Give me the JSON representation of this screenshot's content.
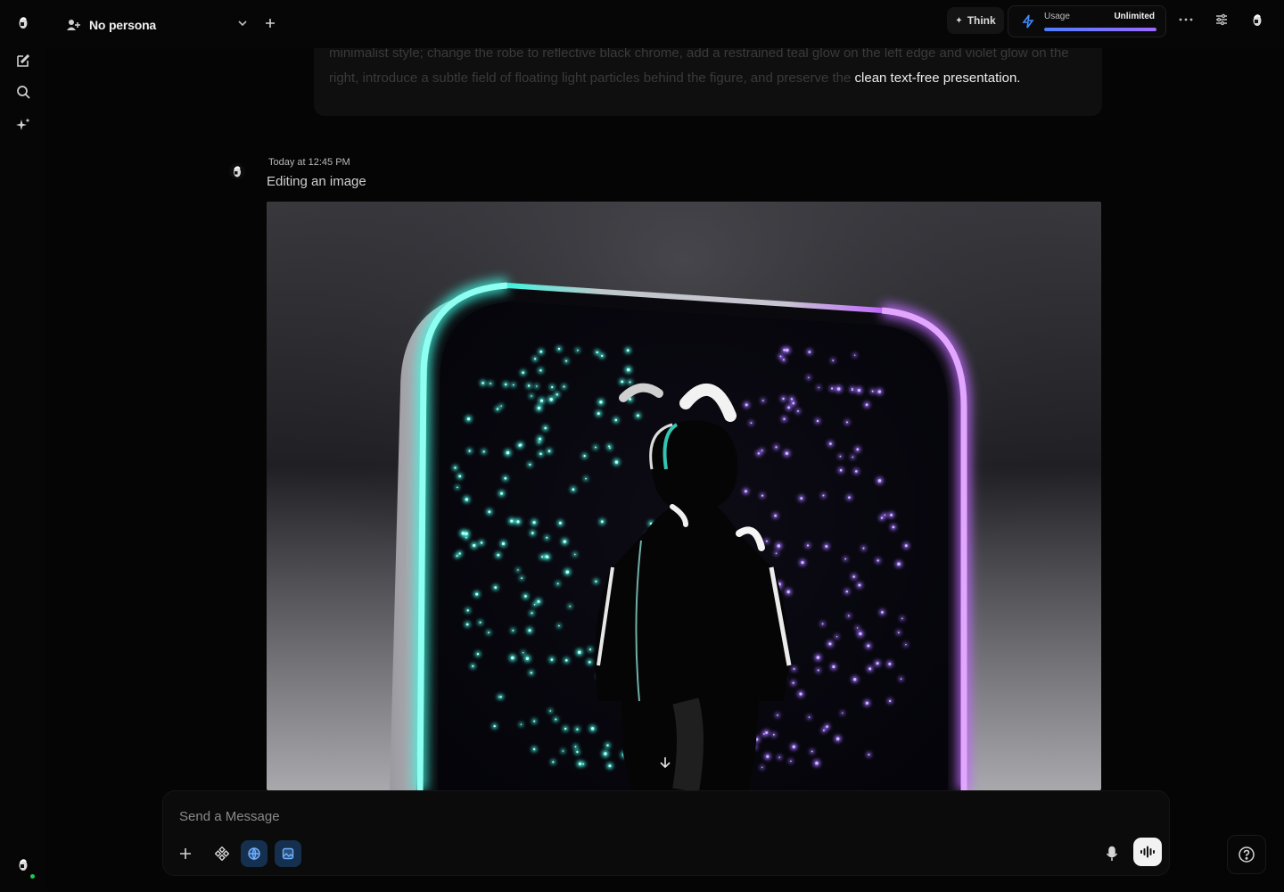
{
  "header": {
    "persona_label": "No persona",
    "think_label": "Think",
    "usage_label": "Usage",
    "usage_value": "Unlimited",
    "usage_fraction": 1.0
  },
  "sidebar": {
    "items": [
      {
        "icon": "logo-icon"
      },
      {
        "icon": "new-chat-icon"
      },
      {
        "icon": "search-icon"
      },
      {
        "icon": "sparkles-icon"
      }
    ]
  },
  "messages": {
    "user": {
      "faded_text": "minimalist style; change the robe to reflective black chrome, add a restrained teal glow on the left edge and violet glow on the right, introduce a subtle field of floating light particles behind the figure, and preserve the",
      "visible_text": "clean text-free presentation."
    },
    "assistant": {
      "timestamp": "Today at 12:45 PM",
      "status": "Editing an image"
    }
  },
  "composer": {
    "placeholder": "Send a Message"
  },
  "colors": {
    "teal": "#3ff5e0",
    "violet": "#b46bff",
    "accent_blue": "#3f8cff",
    "online": "#21c45a"
  }
}
